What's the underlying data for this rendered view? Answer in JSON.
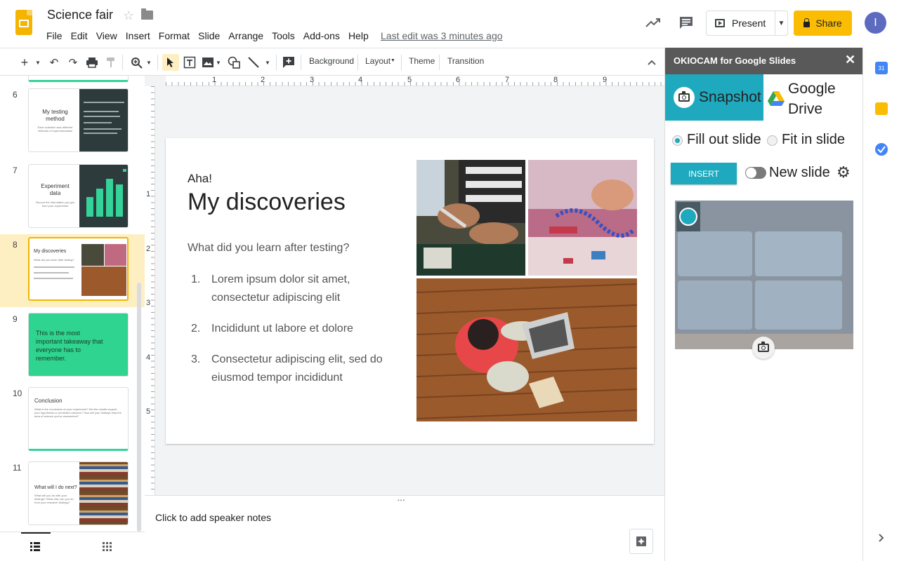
{
  "app": {
    "title": "Science fair",
    "menu": [
      "File",
      "Edit",
      "View",
      "Insert",
      "Format",
      "Slide",
      "Arrange",
      "Tools",
      "Add-ons",
      "Help"
    ],
    "last_edit": "Last edit was 3 minutes ago",
    "present_label": "Present",
    "share_label": "Share",
    "avatar_initial": "I",
    "share_color": "#fbbc04"
  },
  "toolbar": {
    "background": "Background",
    "layout": "Layout",
    "theme": "Theme",
    "transition": "Transition"
  },
  "filmstrip": {
    "slides": [
      {
        "num": "6",
        "title": "My testing method",
        "body": "Each scientist uses different methods of experimentation"
      },
      {
        "num": "7",
        "title": "Experiment data",
        "body": "Record the information you get from your experiment"
      },
      {
        "num": "8",
        "title": "My discoveries",
        "body": "What did you learn after testing?"
      },
      {
        "num": "9",
        "title": "This is the most important takeaway that everyone has to remember."
      },
      {
        "num": "10",
        "title": "Conclusion",
        "body": "What is the conclusion of your experiment? Did the results support your hypothesis or predicted outcome? How will your findings help the area of science you've researched?"
      },
      {
        "num": "11",
        "title": "What will I do next?",
        "body": "What will you do with your findings? What else can you do from your research findings?"
      }
    ]
  },
  "ruler": {
    "h_numbers": [
      "1",
      "2",
      "3",
      "4",
      "5",
      "6",
      "7",
      "8",
      "9"
    ],
    "v_numbers": [
      "1",
      "2",
      "3",
      "4",
      "5"
    ]
  },
  "slide": {
    "eyebrow": "Aha!",
    "title": "My discoveries",
    "subtitle": "What did you learn after testing?",
    "items": [
      {
        "n": "1.",
        "text": "Lorem ipsum dolor sit amet, consectetur adipiscing elit"
      },
      {
        "n": "2.",
        "text": "Incididunt ut labore et dolore"
      },
      {
        "n": "3.",
        "text": "Consectetur adipiscing elit, sed do eiusmod tempor incididunt"
      }
    ]
  },
  "notes": {
    "placeholder": "Click to add speaker notes"
  },
  "addon": {
    "title": "OKIOCAM for Google Slides",
    "snapshot_tab": "Snapshot",
    "drive_tab": "Google Drive",
    "option_fill": "Fill out slide",
    "option_fit": "Fit in slide",
    "selected_option": "Fill out slide",
    "insert_label": "INSERT",
    "new_slide_label": "New slide",
    "accent": "#1fa9be"
  },
  "siderail": {
    "calendar_day": "31"
  }
}
